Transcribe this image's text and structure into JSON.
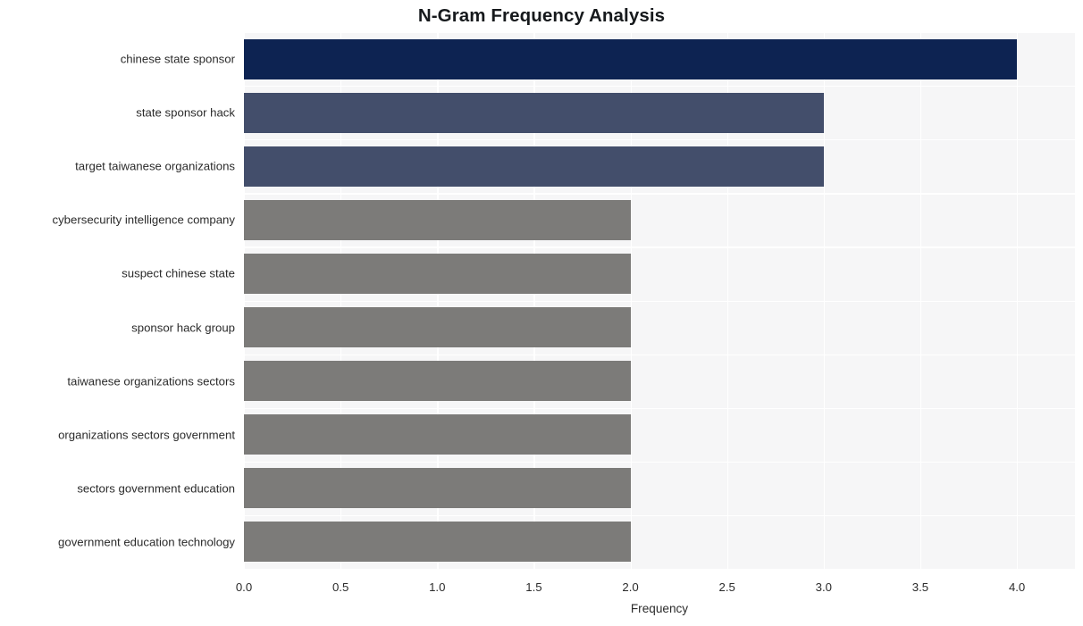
{
  "chart_data": {
    "type": "bar",
    "orientation": "horizontal",
    "title": "N-Gram Frequency Analysis",
    "xlabel": "Frequency",
    "ylabel": "",
    "xlim": [
      0.0,
      4.3
    ],
    "ylim": [
      0,
      10
    ],
    "grid": true,
    "legend": null,
    "xticks": [
      "0.0",
      "0.5",
      "1.0",
      "1.5",
      "2.0",
      "2.5",
      "3.0",
      "3.5",
      "4.0"
    ],
    "xtick_values": [
      0.0,
      0.5,
      1.0,
      1.5,
      2.0,
      2.5,
      3.0,
      3.5,
      4.0
    ],
    "categories": [
      "chinese state sponsor",
      "state sponsor hack",
      "target taiwanese organizations",
      "cybersecurity intelligence company",
      "suspect chinese state",
      "sponsor hack group",
      "taiwanese organizations sectors",
      "organizations sectors government",
      "sectors government education",
      "government education technology"
    ],
    "values": [
      4,
      3,
      3,
      2,
      2,
      2,
      2,
      2,
      2,
      2
    ],
    "bar_colors": [
      "#0d2352",
      "#434e6b",
      "#434e6b",
      "#7c7b79",
      "#7c7b79",
      "#7c7b79",
      "#7c7b79",
      "#7c7b79",
      "#7c7b79",
      "#7c7b79"
    ]
  },
  "style": {
    "figure_background": "#ffffff",
    "axes_background": "#f6f6f7",
    "grid_color": "#ffffff",
    "title_color": "#16191c",
    "tick_color": "#2b2b2b"
  }
}
